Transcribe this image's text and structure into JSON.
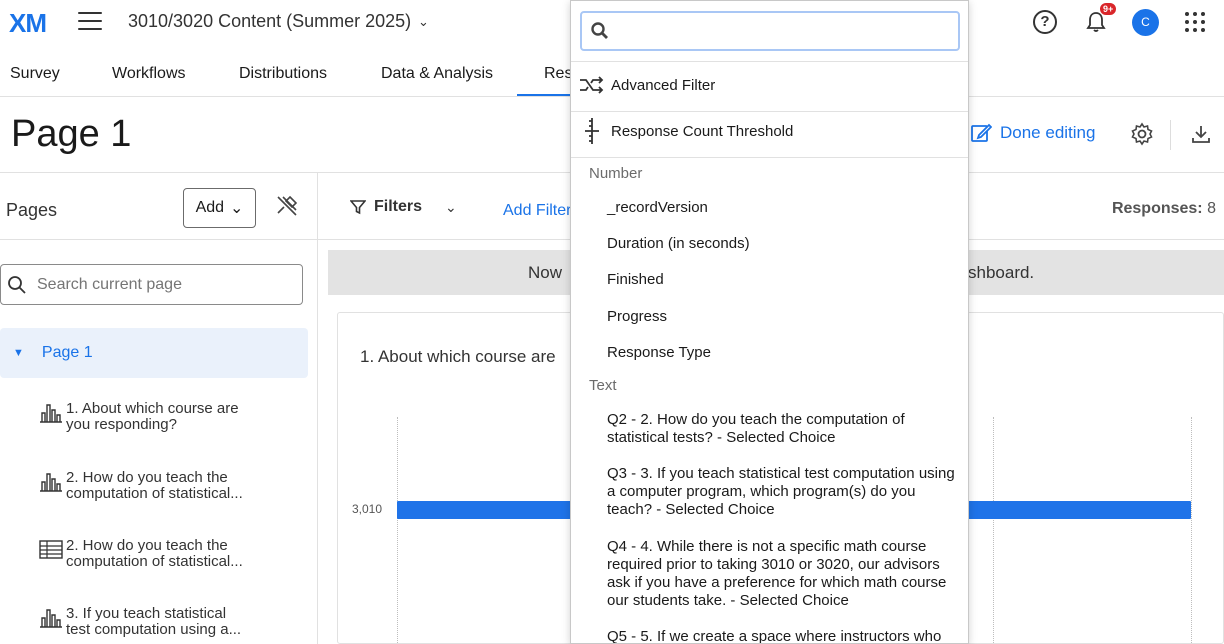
{
  "app": {
    "logo": "XM",
    "project_title": "3010/3020 Content (Summer 2025)",
    "notification_badge": "9+",
    "avatar_initial": "C"
  },
  "nav": {
    "tabs": [
      "Survey",
      "Workflows",
      "Distributions",
      "Data & Analysis",
      "Res"
    ]
  },
  "header": {
    "page_title": "Page 1",
    "done_editing": "Done editing"
  },
  "left": {
    "pages_label": "Pages",
    "add_label": "Add",
    "search_placeholder": "Search current page",
    "page1_label": "Page 1",
    "questions": [
      {
        "line1": "1. About which course are",
        "line2": "you responding?",
        "icon": "bar-chart-icon"
      },
      {
        "line1": "2. How do you teach the",
        "line2": "computation of statistical...",
        "icon": "bar-chart-icon"
      },
      {
        "line1": "2. How do you teach the",
        "line2": "computation of statistical...",
        "icon": "table-icon"
      },
      {
        "line1": "3. If you teach statistical",
        "line2": "test computation using a...",
        "icon": "bar-chart-icon"
      }
    ]
  },
  "main": {
    "filters_label": "Filters",
    "add_filter_label": "Add Filter",
    "responses_label": "Responses:",
    "responses_value": "8",
    "notice_left": "Now",
    "notice_right": "shboard.",
    "card_title": "1. About which course are",
    "bar_category": "3,010"
  },
  "dropdown": {
    "search_value": "",
    "advanced_filter": "Advanced Filter",
    "response_count_threshold": "Response Count Threshold",
    "number_section": "Number",
    "number_items": [
      "_recordVersion",
      "Duration (in seconds)",
      "Finished",
      "Progress",
      "Response Type"
    ],
    "text_section": "Text",
    "text_items": [
      "Q2 - 2. How do you teach the computation of statistical tests? - Selected Choice",
      "Q3 - 3. If you teach statistical test computation using a computer program, which program(s) do you teach? - Selected Choice",
      "Q4 - 4. While there is not a specific math course required prior to taking 3010 or 3020, our advisors ask if you have a preference for which math course our students take. - Selected Choice",
      "Q5 - 5. If we create a space where instructors who"
    ]
  },
  "colors": {
    "accent": "#1a73e8",
    "bar": "#1f73e8",
    "badge": "#d9262a"
  }
}
